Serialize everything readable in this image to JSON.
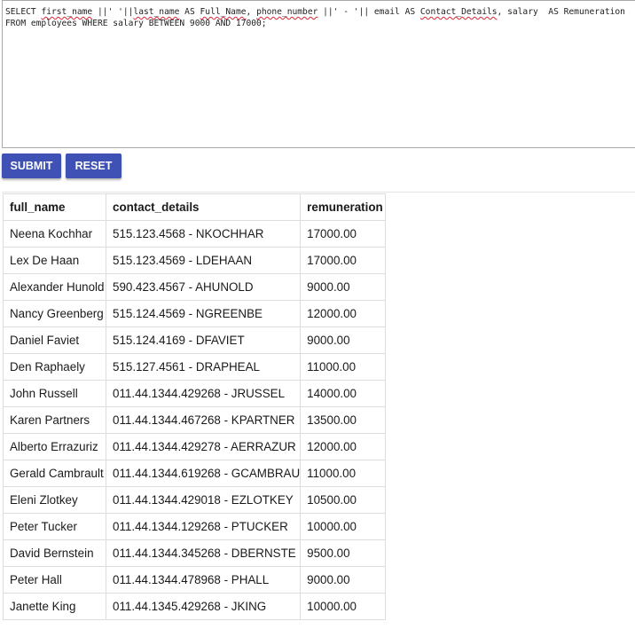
{
  "editor": {
    "line1_parts": [
      "SELECT ",
      "first_name",
      " ||' '||",
      "last_name",
      " AS ",
      "Full_Name",
      ", ",
      "phone_number",
      " ||' - '|| email AS ",
      "Contact_Details",
      ", salary  AS Remuneration"
    ],
    "line2": "FROM employees WHERE salary BETWEEN 9000 AND 17000;"
  },
  "buttons": {
    "submit_label": "SUBMIT",
    "reset_label": "RESET"
  },
  "colors": {
    "button_bg": "#3f51b5",
    "spellcheck_underline": "#d23"
  },
  "table": {
    "columns": [
      "full_name",
      "contact_details",
      "remuneration"
    ],
    "rows": [
      [
        "Neena Kochhar",
        "515.123.4568 - NKOCHHAR",
        "17000.00"
      ],
      [
        "Lex De Haan",
        "515.123.4569 - LDEHAAN",
        "17000.00"
      ],
      [
        "Alexander Hunold",
        "590.423.4567 - AHUNOLD",
        "9000.00"
      ],
      [
        "Nancy Greenberg",
        "515.124.4569 - NGREENBE",
        "12000.00"
      ],
      [
        "Daniel Faviet",
        "515.124.4169 - DFAVIET",
        "9000.00"
      ],
      [
        "Den Raphaely",
        "515.127.4561 - DRAPHEAL",
        "11000.00"
      ],
      [
        "John Russell",
        "011.44.1344.429268 - JRUSSEL",
        "14000.00"
      ],
      [
        "Karen Partners",
        "011.44.1344.467268 - KPARTNER",
        "13500.00"
      ],
      [
        "Alberto Errazuriz",
        "011.44.1344.429278 - AERRAZUR",
        "12000.00"
      ],
      [
        "Gerald Cambrault",
        "011.44.1344.619268 - GCAMBRAU",
        "11000.00"
      ],
      [
        "Eleni Zlotkey",
        "011.44.1344.429018 - EZLOTKEY",
        "10500.00"
      ],
      [
        "Peter Tucker",
        "011.44.1344.129268 - PTUCKER",
        "10000.00"
      ],
      [
        "David Bernstein",
        "011.44.1344.345268 - DBERNSTE",
        "9500.00"
      ],
      [
        "Peter Hall",
        "011.44.1344.478968 - PHALL",
        "9000.00"
      ],
      [
        "Janette King",
        "011.44.1345.429268 - JKING",
        "10000.00"
      ]
    ]
  }
}
